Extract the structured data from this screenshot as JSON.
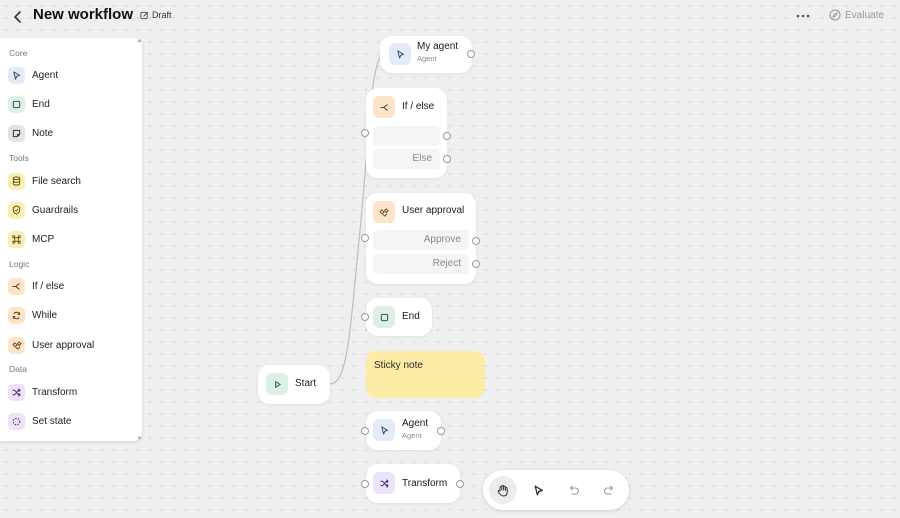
{
  "header": {
    "title": "New workflow",
    "status": "Draft",
    "evaluate_label": "Evaluate",
    "icons": {
      "back": "chevron-left-icon",
      "more": "more-horizontal-icon",
      "evaluate": "compass-icon",
      "draft": "edit-icon"
    }
  },
  "sidebar": {
    "sections": [
      {
        "title": "Core",
        "items": [
          {
            "label": "Agent",
            "icon": "agent-cursor-icon",
            "color": "#e3ebf9"
          },
          {
            "label": "End",
            "icon": "stop-square-icon",
            "color": "#dcf0e6"
          },
          {
            "label": "Note",
            "icon": "note-icon",
            "color": "#e4e4e4"
          }
        ]
      },
      {
        "title": "Tools",
        "items": [
          {
            "label": "File search",
            "icon": "database-icon",
            "color": "#fbefb0"
          },
          {
            "label": "Guardrails",
            "icon": "shield-icon",
            "color": "#fbefb0"
          },
          {
            "label": "MCP",
            "icon": "mcp-icon",
            "color": "#fbefb0"
          }
        ]
      },
      {
        "title": "Logic",
        "items": [
          {
            "label": "If / else",
            "icon": "branch-icon",
            "color": "#fbe4c8"
          },
          {
            "label": "While",
            "icon": "loop-icon",
            "color": "#fbe4c8"
          },
          {
            "label": "User approval",
            "icon": "approval-icon",
            "color": "#fbe4c8"
          }
        ]
      },
      {
        "title": "Data",
        "items": [
          {
            "label": "Transform",
            "icon": "shuffle-icon",
            "color": "#ece2fb"
          },
          {
            "label": "Set state",
            "icon": "dashed-circle-icon",
            "color": "#ece2fb"
          }
        ]
      }
    ]
  },
  "canvas": {
    "start": {
      "label": "Start"
    },
    "my_agent": {
      "label": "My agent",
      "sub": "Agent"
    },
    "if_else": {
      "label": "If / else",
      "else_label": "Else"
    },
    "user_approval": {
      "label": "User approval",
      "approve_label": "Approve",
      "reject_label": "Reject"
    },
    "end": {
      "label": "End"
    },
    "sticky": {
      "text": "Sticky note",
      "color": "#fdeca5"
    },
    "agent": {
      "label": "Agent",
      "sub": "Agent"
    },
    "transform": {
      "label": "Transform"
    }
  },
  "toolbar": {
    "tools": [
      "hand-icon",
      "pointer-icon",
      "undo-icon",
      "redo-icon"
    ],
    "active": "hand-icon"
  }
}
